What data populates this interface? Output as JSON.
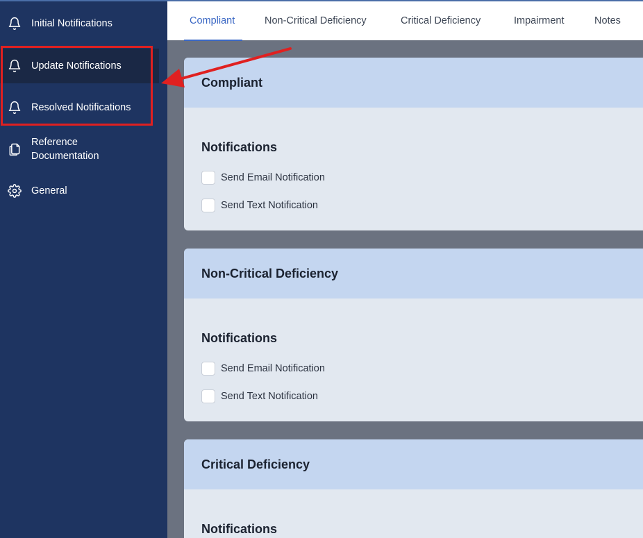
{
  "sidebar": {
    "items": [
      {
        "label": "Initial Notifications",
        "icon": "bell-icon"
      },
      {
        "label": "Update Notifications",
        "icon": "bell-icon"
      },
      {
        "label": "Resolved Notifications",
        "icon": "bell-icon"
      },
      {
        "label": "Reference\nDocumentation",
        "icon": "document-copy-icon"
      },
      {
        "label": "General",
        "icon": "gear-icon"
      }
    ],
    "active_index": 1
  },
  "tabs": [
    {
      "label": "Compliant"
    },
    {
      "label": "Non-Critical Deficiency"
    },
    {
      "label": "Critical Deficiency"
    },
    {
      "label": "Impairment"
    },
    {
      "label": "Notes"
    }
  ],
  "cards": [
    {
      "title": "Compliant",
      "section": "Notifications",
      "options": [
        "Send Email Notification",
        "Send Text Notification"
      ]
    },
    {
      "title": "Non-Critical Deficiency",
      "section": "Notifications",
      "options": [
        "Send Email Notification",
        "Send Text Notification"
      ]
    },
    {
      "title": "Critical Deficiency",
      "section": "Notifications"
    }
  ],
  "colors": {
    "sidebar_bg": "#1e3461",
    "active_item_bg": "#1a2845",
    "accent": "#3a67c4",
    "annotation_red": "#e02020",
    "card_header_bg": "#c4d6f0",
    "card_bg": "#e2e8f0"
  }
}
